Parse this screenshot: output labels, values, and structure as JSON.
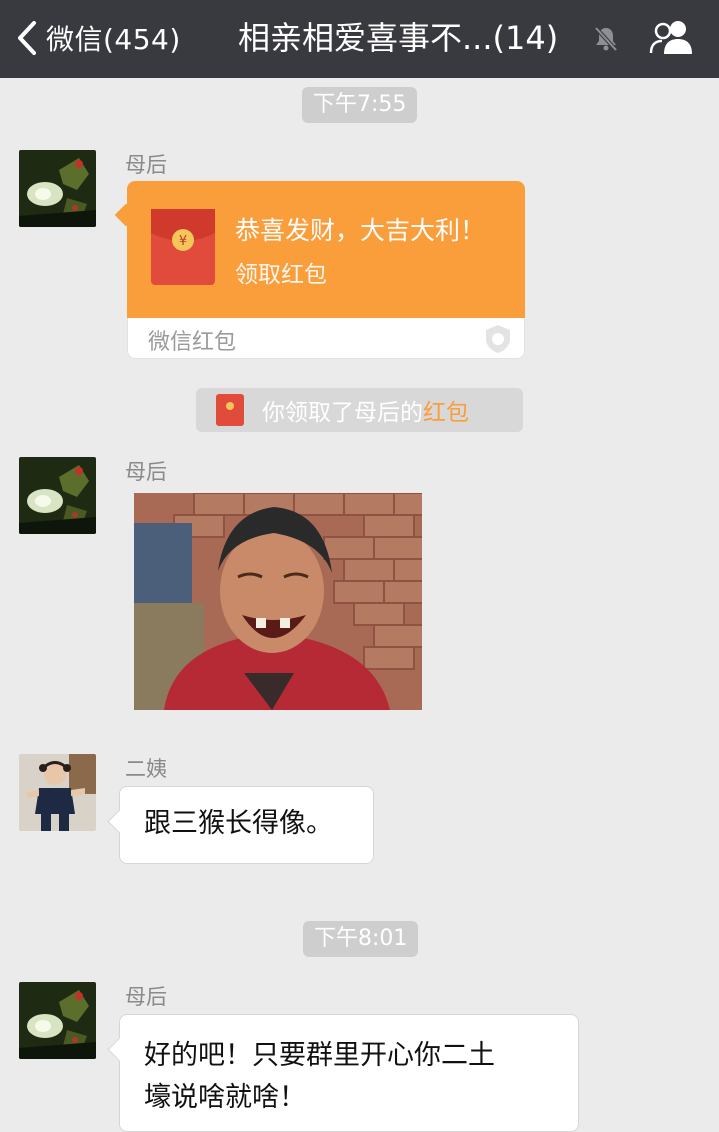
{
  "header": {
    "back_label": "微信(454)",
    "title": "相亲相爱喜事不...(14)",
    "mute_icon": "muted-bell-icon",
    "group_icon": "group-members-icon",
    "bg_color": "#393a3f"
  },
  "times": [
    "下午7:55",
    "下午8:01"
  ],
  "messages": [
    {
      "sender": "母后",
      "type": "red_packet",
      "greeting": "恭喜发财，大吉大利！",
      "action": "领取红包",
      "brand": "微信红包",
      "color": "#fa9d3b"
    },
    {
      "type": "notice",
      "text_prefix": "你领取了母后的",
      "link": "红包"
    },
    {
      "sender": "母后",
      "type": "image"
    },
    {
      "sender": "二姨",
      "type": "text",
      "text": "跟三猴长得像。"
    },
    {
      "sender": "母后",
      "type": "text",
      "lines": [
        "好的吧！只要群里开心你二土",
        "壕说啥就啥！"
      ]
    }
  ]
}
